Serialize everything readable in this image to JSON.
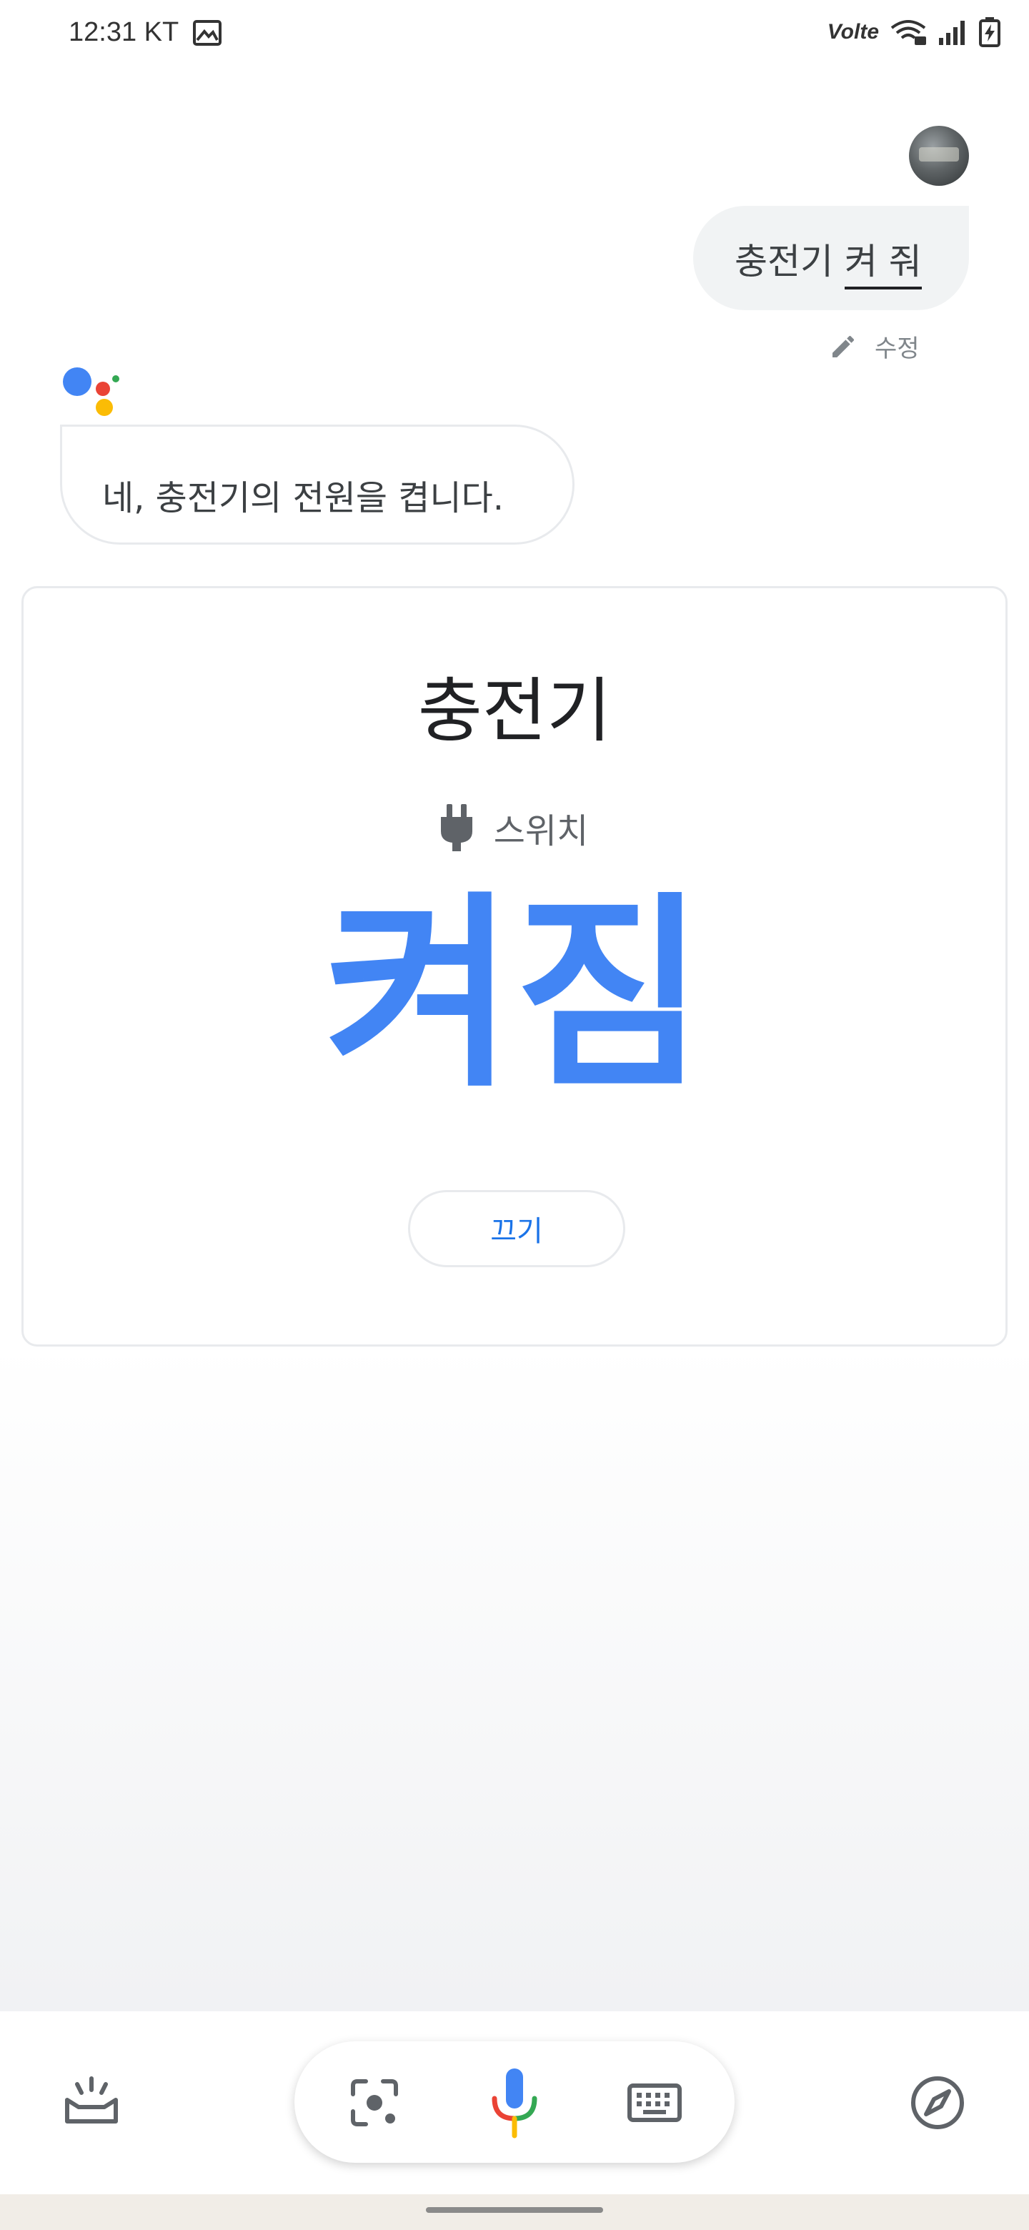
{
  "status_bar": {
    "time": "12:31",
    "carrier": "KT",
    "network": "Volte",
    "icons": [
      "gallery-icon",
      "volte-icon",
      "wifi-icon",
      "signal-icon",
      "battery-charging-icon"
    ]
  },
  "conversation": {
    "user_query_prefix": "충전기 ",
    "user_query_underlined": "켜 줘",
    "edit_label": "수정",
    "assistant_reply": "네, 충전기의 전원을 켭니다."
  },
  "device_card": {
    "device_name": "충전기",
    "device_type_icon": "plug-icon",
    "device_type": "스위치",
    "state": "켜짐",
    "toggle_button_label": "끄기"
  },
  "bottom_bar": {
    "icons": [
      "updates-icon",
      "lens-icon",
      "mic-icon",
      "keyboard-icon",
      "explore-icon"
    ]
  },
  "colors": {
    "accent_blue": "#4285f4",
    "google_red": "#ea4335",
    "google_yellow": "#fbbc05",
    "google_green": "#34a853",
    "bubble_gray": "#f1f3f4"
  }
}
